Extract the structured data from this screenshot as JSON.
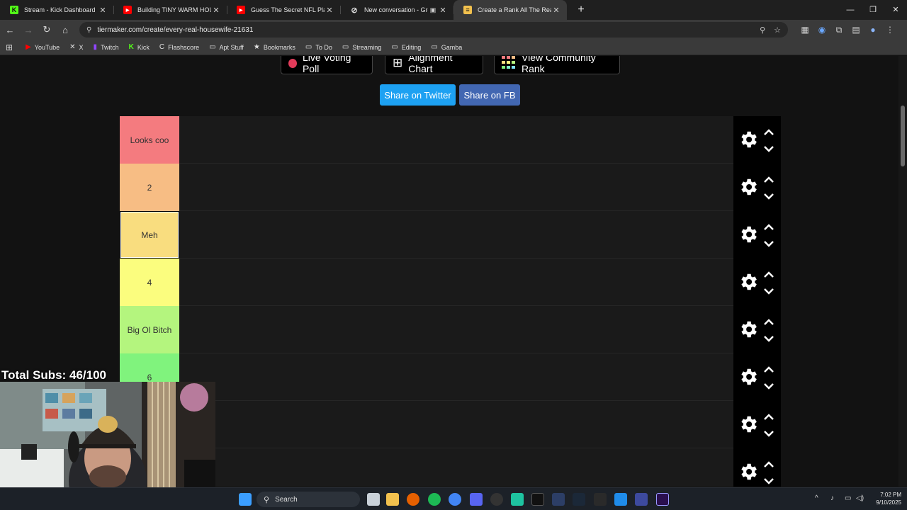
{
  "browser": {
    "tabs": [
      {
        "title": "Stream - Kick Dashboard",
        "icon": "kick-icon",
        "color": "#53fc18",
        "glyph": "K"
      },
      {
        "title": "Building TINY WARM HOUSE w",
        "icon": "youtube-icon",
        "color": "#ff0000",
        "glyph": "▶"
      },
      {
        "title": "Guess The Secret NFL Player ft",
        "icon": "youtube-icon",
        "color": "#ff0000",
        "glyph": "▶"
      },
      {
        "title": "New conversation - Grok",
        "icon": "grok-icon",
        "color": "#dddddd",
        "glyph": "⊘"
      },
      {
        "title": "Create a Rank All The Real Hou",
        "icon": "tiermaker-icon",
        "color": "#f2c14e",
        "glyph": "≡",
        "active": true
      }
    ],
    "url": "tiermaker.com/create/every-real-housewife-21631",
    "bookmarks": [
      {
        "label": "YouTube",
        "icon": "youtube-icon",
        "glyph": "▶",
        "color": "#ff0000"
      },
      {
        "label": "X",
        "icon": "x-icon",
        "glyph": "𝕏",
        "color": "#ffffff"
      },
      {
        "label": "Twitch",
        "icon": "twitch-icon",
        "glyph": "▮",
        "color": "#9146ff"
      },
      {
        "label": "Kick",
        "icon": "kick-icon",
        "glyph": "K",
        "color": "#53fc18"
      },
      {
        "label": "Flashscore",
        "icon": "flashscore-icon",
        "glyph": "C",
        "color": "#cccccc"
      },
      {
        "label": "Apt Stuff",
        "icon": "folder-icon",
        "glyph": "▭",
        "color": "#cccccc"
      },
      {
        "label": "Bookmarks",
        "icon": "star-icon",
        "glyph": "★",
        "color": "#cccccc"
      },
      {
        "label": "To Do",
        "icon": "folder-icon",
        "glyph": "▭",
        "color": "#cccccc"
      },
      {
        "label": "Streaming",
        "icon": "folder-icon",
        "glyph": "▭",
        "color": "#cccccc"
      },
      {
        "label": "Editing",
        "icon": "folder-icon",
        "glyph": "▭",
        "color": "#cccccc"
      },
      {
        "label": "Gamba",
        "icon": "folder-icon",
        "glyph": "▭",
        "color": "#cccccc"
      }
    ]
  },
  "page": {
    "buttons": {
      "live_poll": "Live Voting Poll",
      "alignment": "Alignment Chart",
      "community": "View Community Rank",
      "share_twitter": "Share on Twitter",
      "share_fb": "Share on FB"
    },
    "tiers": [
      {
        "label": "Looks coo",
        "color": "#f47b7f"
      },
      {
        "label": "2",
        "color": "#f7bd84"
      },
      {
        "label": "Meh",
        "color": "#f9dd7f"
      },
      {
        "label": "4",
        "color": "#fbfd7e"
      },
      {
        "label": "Big Ol Bitch",
        "color": "#b4f57e"
      },
      {
        "label": "6",
        "color": "#80f37d"
      },
      {
        "label": "",
        "color": "#7ef5c9"
      },
      {
        "label": "",
        "color": "#7fdffc"
      }
    ]
  },
  "overlay": {
    "subs_text": "Total Subs: 46/100"
  },
  "taskbar": {
    "search_placeholder": "Search",
    "time": "7:02 PM",
    "date": "9/10/2025"
  }
}
